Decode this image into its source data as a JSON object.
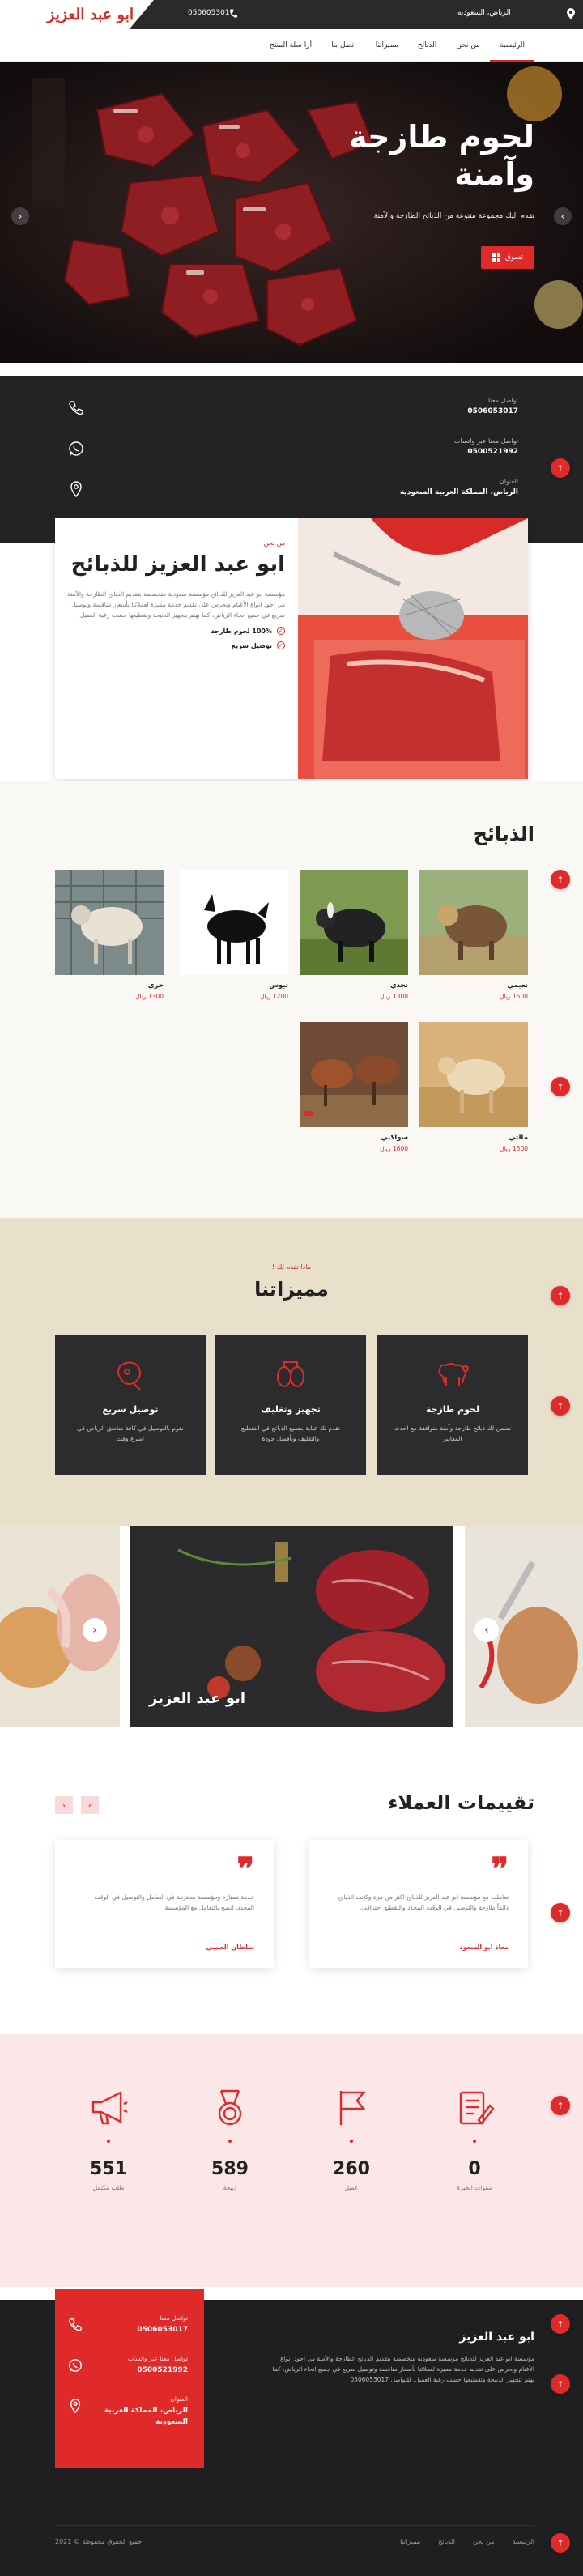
{
  "header": {
    "brand": "ابو عبد العزيز",
    "phone": "0506053017",
    "location": "الرياض، السعودية"
  },
  "nav": {
    "items": [
      "الرئيسية",
      "من نحن",
      "الذبائح",
      "مميزاتنا",
      "اتصل بنا",
      "أرا سلة المنتج"
    ]
  },
  "hero": {
    "title": "لحوم طازجة وآمنة",
    "subtitle": "نقدم اليك مجموعة متنوعة من الذبائح الطازجة والآمنة",
    "button_label": "تسوق"
  },
  "contact": {
    "items": [
      {
        "label": "تواصل معنا",
        "value": "0506053017"
      },
      {
        "label": "تواصل معنا عبر واتساب",
        "value": "0500521992"
      },
      {
        "label": "العنوان",
        "value": "الرياض، المملكة العربية السعودية"
      }
    ]
  },
  "about": {
    "kicker": "من نحن",
    "title": "ابو عبد العزيز للذبائح",
    "paragraph": "مؤسسة ابو عبد العزيز للذبائح مؤسسة سعودية متخصصة بتقديم الذبائح الطازجة والآمنة من اجود انواع الأغنام ونحرص على تقديم خدمة مميزة لعملائنا بأسعار منافسة وتوصيل سريع في جميع انحاء الرياض، كما نهتم بتجهيز الذبيحة وتقطيعها حسب رغبة العميل.",
    "checks": [
      "100% لحوم طازجة",
      "توصيل سريع"
    ]
  },
  "products": {
    "title": "الذبائح",
    "currency": "ريال",
    "items": [
      {
        "name": "نعيمي",
        "price": "1500"
      },
      {
        "name": "نجدي",
        "price": "1300"
      },
      {
        "name": "تيوس",
        "price": "1200"
      },
      {
        "name": "حري",
        "price": "1300"
      },
      {
        "name": "مالتي",
        "price": "1500"
      },
      {
        "name": "سواكني",
        "price": "1600"
      }
    ]
  },
  "features": {
    "kicker": "ماذا نقدم لك !",
    "title": "مميزاتنا",
    "items": [
      {
        "title": "لحوم طازجة",
        "desc": "نضمن لك ذبائح طازجة وآمنة متوافقة مع احدث المعايير"
      },
      {
        "title": "تجهيز وتغليف",
        "desc": "نقدم لك عناية بجميع الذبائح في التقطيع والتغليف وبأفضل جودة"
      },
      {
        "title": "توصيل سريع",
        "desc": "نقوم بالتوصيل في كافة مناطق الرياض في اسرع وقت"
      }
    ]
  },
  "gallery": {
    "caption": "ابو عبد العزيز"
  },
  "testimonials": {
    "title": "تقييمات العملاء",
    "items": [
      {
        "text": "تعاملت مع مؤسسة ابو عبد العزيز للذبائح اكثر من مرة وكانت الذبائح دائماً طازجة والتوصيل في الوقت المحدد والتقطيع احترافي.",
        "name": "معاذ ابو السعود"
      },
      {
        "text": "خدمة ممتازة ومؤسسة محترمة في التعامل والتوصيل في الوقت المحدد، انصح بالتعامل مع المؤسسة.",
        "name": "سلطان العتيبي"
      }
    ]
  },
  "stats": {
    "items": [
      {
        "value": "0",
        "label": "سنوات الخبرة"
      },
      {
        "value": "260",
        "label": "عميل"
      },
      {
        "value": "589",
        "label": "ذبيحة"
      },
      {
        "value": "551",
        "label": "طلب مكتمل"
      }
    ]
  },
  "footer": {
    "brand": "ابو عبد العزيز",
    "paragraph": "مؤسسة ابو عبد العزيز للذبائح مؤسسة سعودية متخصصة بتقديم الذبائح الطازجة والآمنة من اجود انواع الأغنام ونحرص على تقديم خدمة مميزة لعملائنا بأسعار منافسة وتوصيل سريع في جميع انحاء الرياض، كما نهتم بتجهيز الذبيحة وتقطيعها حسب رغبة العميل. للتواصل 0506053017",
    "contact": [
      {
        "label": "تواصل معنا",
        "value": "0506053017"
      },
      {
        "label": "تواصل معنا عبر واتساب",
        "value": "0500521992"
      },
      {
        "label": "العنوان",
        "value": "الرياض، المملكة العربية السعودية"
      }
    ],
    "links": [
      "الرئيسية",
      "من نحن",
      "الذبائح",
      "مميزاتنا"
    ],
    "copyright": "جميع الحقوق محفوظة © 2021"
  },
  "colors": {
    "accent": "#e02a2a",
    "dark": "#232325",
    "beige": "#e9e0cc",
    "pink": "#fbe7e7"
  }
}
